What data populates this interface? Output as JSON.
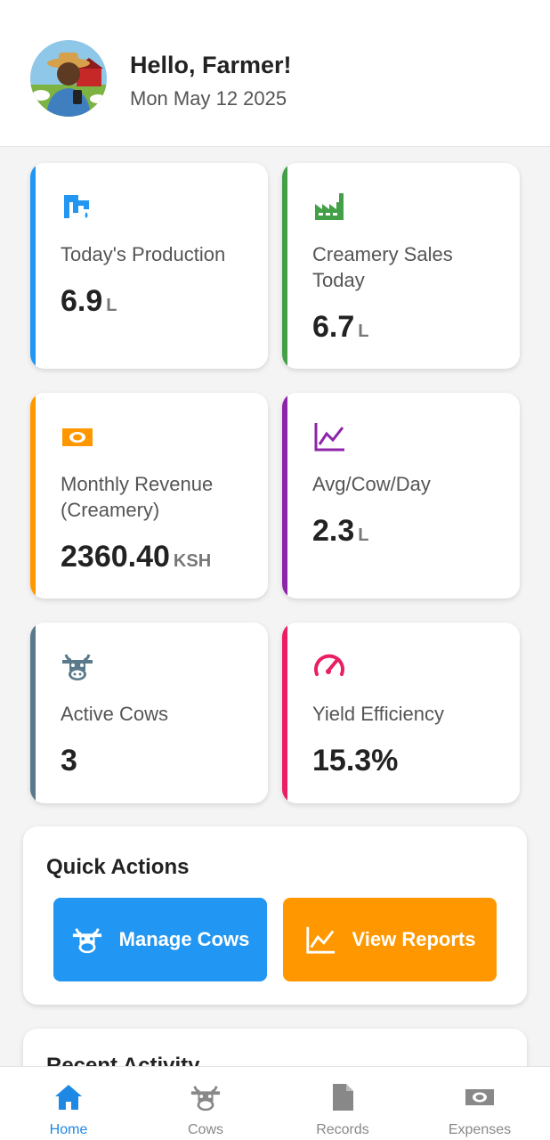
{
  "header": {
    "greeting": "Hello, Farmer!",
    "date": "Mon May 12 2025",
    "avatar_icon": "farmer-avatar"
  },
  "cards": [
    {
      "id": "todays-production",
      "label": "Today's Production",
      "value": "6.9",
      "unit": "L",
      "accent": "#2196f3",
      "icon": "milk-tap-icon"
    },
    {
      "id": "creamery-sales",
      "label": "Creamery Sales Today",
      "value": "6.7",
      "unit": "L",
      "accent": "#43a047",
      "icon": "factory-icon"
    },
    {
      "id": "monthly-revenue",
      "label": "Monthly Revenue (Creamery)",
      "value": "2360.40",
      "unit": "KSH",
      "accent": "#ff9800",
      "icon": "money-icon"
    },
    {
      "id": "avg-cow-day",
      "label": "Avg/Cow/Day",
      "value": "2.3",
      "unit": "L",
      "accent": "#8e24aa",
      "icon": "line-chart-icon"
    },
    {
      "id": "active-cows",
      "label": "Active Cows",
      "value": "3",
      "unit": "",
      "accent": "#5a7a8c",
      "icon": "cow-icon"
    },
    {
      "id": "yield-efficiency",
      "label": "Yield Efficiency",
      "value": "15.3%",
      "unit": "",
      "accent": "#e91e63",
      "icon": "speedometer-icon"
    }
  ],
  "quick_actions": {
    "title": "Quick Actions",
    "manage_cows": {
      "label": "Manage Cows",
      "color": "#2196f3",
      "icon": "cow-icon"
    },
    "view_reports": {
      "label": "View Reports",
      "color": "#ff9800",
      "icon": "line-chart-icon"
    }
  },
  "recent_activity": {
    "title": "Recent Activity"
  },
  "nav": [
    {
      "label": "Home",
      "icon": "home-icon",
      "active": true
    },
    {
      "label": "Cows",
      "icon": "cow-icon",
      "active": false
    },
    {
      "label": "Records",
      "icon": "document-icon",
      "active": false
    },
    {
      "label": "Expenses",
      "icon": "money-icon",
      "active": false
    }
  ]
}
